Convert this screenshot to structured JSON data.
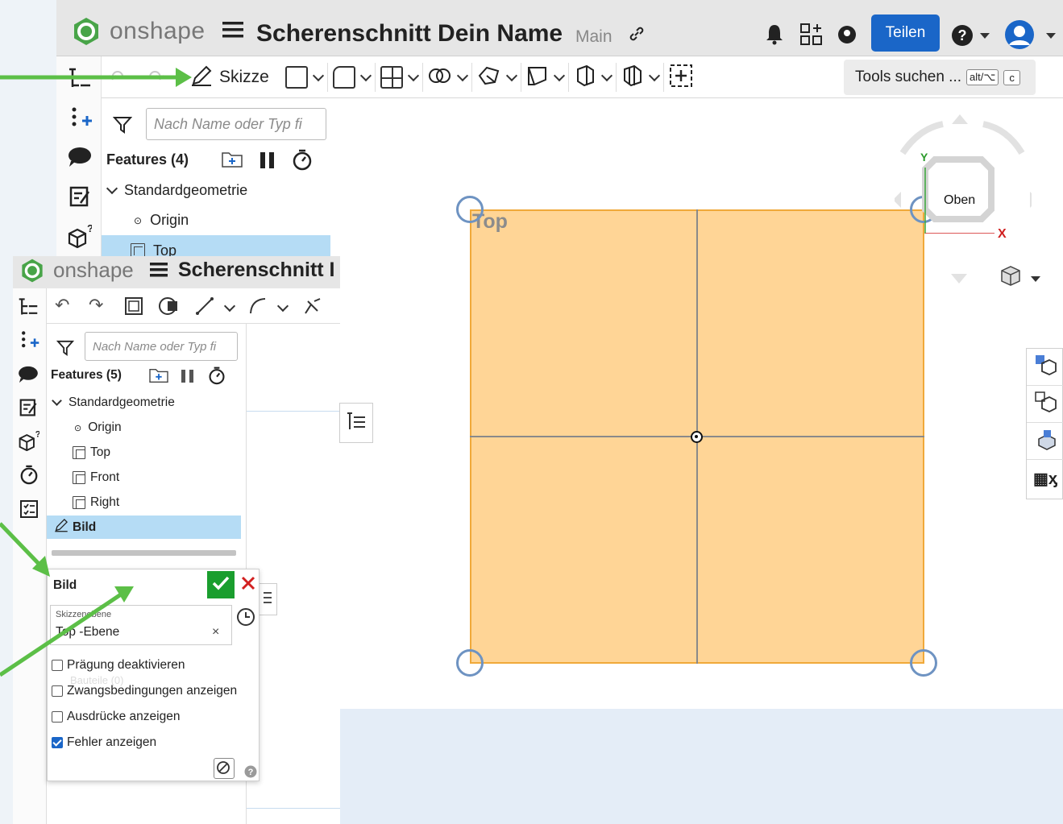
{
  "back_window": {
    "logo": "onshape",
    "doc_title": "Scherenschnitt Dein Name",
    "branch": "Main",
    "share_label": "Teilen",
    "sketch_label": "Skizze",
    "tools_search": "Tools suchen ...",
    "shortcut_alt": "alt/⌥",
    "shortcut_key": "c",
    "search_placeholder": "Nach Name oder Typ fi",
    "features_header": "Features (4)",
    "tree_group": "Standardgeometrie",
    "tree_origin": "Origin",
    "tree_top": "Top"
  },
  "canvas": {
    "plane_label": "Top",
    "view_cube_label": "Oben",
    "axis_y": "Y",
    "axis_x": "X"
  },
  "front_window": {
    "logo": "onshape",
    "doc_title": "Scherenschnitt I",
    "search_placeholder": "Nach Name oder Typ fi",
    "features_header": "Features (5)",
    "tree_group": "Standardgeometrie",
    "tree_items": [
      "Origin",
      "Top",
      "Front",
      "Right"
    ],
    "tree_selected": "Bild"
  },
  "dialog": {
    "title": "Bild",
    "field_label": "Skizzenebene",
    "field_value": "Top -Ebene",
    "ghost_text": "Bauteile (0)",
    "options": [
      {
        "label": "Prägung deaktivieren",
        "checked": false
      },
      {
        "label": "Zwangsbedingungen anzeigen",
        "checked": false
      },
      {
        "label": "Ausdrücke anzeigen",
        "checked": false
      },
      {
        "label": "Fehler anzeigen",
        "checked": true
      }
    ]
  },
  "colors": {
    "accent": "#1a66c8",
    "plane_fill": "#ffd596",
    "plane_border": "#f0a93a",
    "arrow": "#5cbf47",
    "selection": "#b5dcf5",
    "accept": "#1a9e2e",
    "cancel": "#d22020"
  }
}
